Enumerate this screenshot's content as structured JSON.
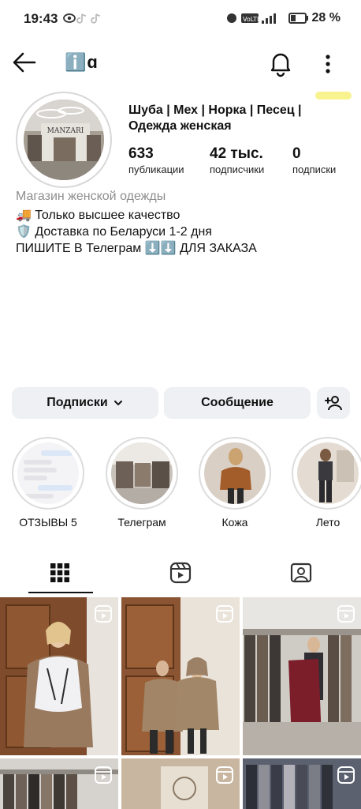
{
  "status_bar": {
    "time": "19:43",
    "battery": "28 %"
  },
  "header": {
    "username": "ℹ️ɑ"
  },
  "profile": {
    "name": "Шуба | Мех | Норка | Песец | Одежда женская",
    "posts_count": "633",
    "posts_label": "публикации",
    "followers_count": "42 тыс.",
    "followers_label": "подписчики",
    "following_count": "0",
    "following_label": "подписки",
    "category": "Магазин женской одежды",
    "bio": [
      "🚚 Только высшее качество",
      "🛡️ Доставка по Беларуси 1-2 дня",
      "ПИШИТЕ В Телеграм ⬇️⬇️ ДЛЯ ЗАКАЗА"
    ]
  },
  "buttons": {
    "following": "Подписки",
    "message": "Сообщение"
  },
  "highlights": [
    {
      "label": "ОТЗЫВЫ 5"
    },
    {
      "label": "Телеграм"
    },
    {
      "label": "Кожа"
    },
    {
      "label": "Лето"
    }
  ],
  "avatar_sign": "MANZARI",
  "tabs": [
    "grid-icon",
    "reels-icon",
    "tagged-icon"
  ],
  "colors": {
    "button_bg": "#eef0f3",
    "secondary_text": "#8e8e8e"
  }
}
